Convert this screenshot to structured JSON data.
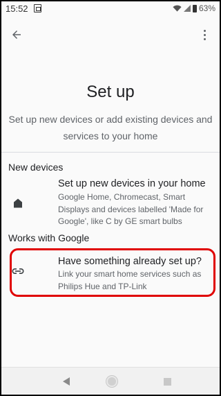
{
  "status_bar": {
    "time": "15:52",
    "battery": "63%"
  },
  "app_bar": {
    "back_icon": "arrow-back-icon",
    "menu_icon": "more-vert-icon"
  },
  "header": {
    "title": "Set up",
    "subtitle": "Set up new devices or add existing devices and services to your home"
  },
  "sections": {
    "new_devices": {
      "label": "New devices",
      "item": {
        "icon": "home-icon",
        "title": "Set up new devices in your home",
        "description": "Google Home, Chromecast, Smart Displays and devices labelled 'Made for Google', like C by GE smart bulbs"
      }
    },
    "works_with_google": {
      "label": "Works with Google",
      "item": {
        "icon": "link-icon",
        "title": "Have something already set up?",
        "description": "Link your smart home services such as Philips Hue and TP-Link"
      }
    }
  },
  "annotation": {
    "highlight_color": "#e00000"
  },
  "nav_bar": {
    "buttons": [
      "back",
      "home",
      "recents"
    ]
  }
}
